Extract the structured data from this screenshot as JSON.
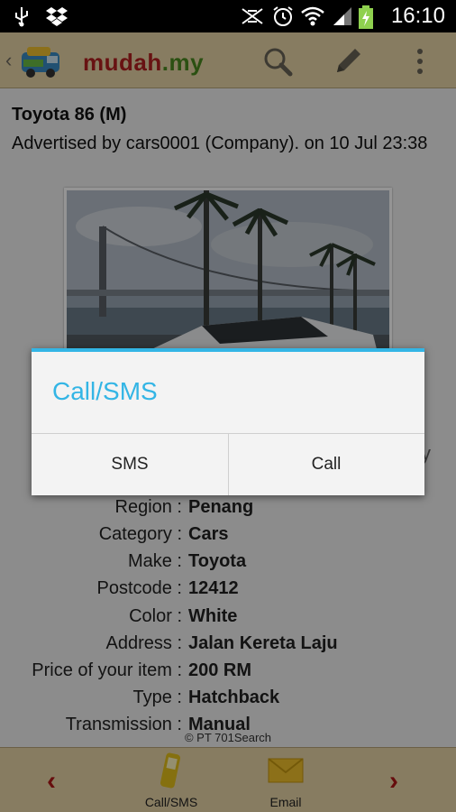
{
  "status_bar": {
    "time": "16:10",
    "icons": [
      "usb-icon",
      "dropbox-icon",
      "mute-icon",
      "alarm-icon",
      "wifi-icon",
      "signal-icon",
      "battery-charging-icon"
    ]
  },
  "action_bar": {
    "logo_text": "mudah",
    "logo_suffix": ".my",
    "icons": [
      "back-chevron-icon",
      "search-icon",
      "edit-icon",
      "overflow-menu-icon"
    ]
  },
  "ad": {
    "title": "Toyota 86 (M)",
    "advertiser_line": "Advertised by cars0001 (Company). on 10 Jul 23:38",
    "partial_text": "y",
    "details": [
      {
        "label": "Region :",
        "value": "Penang"
      },
      {
        "label": "Category :",
        "value": "Cars"
      },
      {
        "label": "Make :",
        "value": "Toyota"
      },
      {
        "label": "Postcode :",
        "value": "12412"
      },
      {
        "label": "Color :",
        "value": "White"
      },
      {
        "label": "Address :",
        "value": "Jalan Kereta Laju"
      },
      {
        "label": "Price of your item :",
        "value": "200 RM"
      },
      {
        "label": "Type :",
        "value": "Hatchback"
      },
      {
        "label": "Transmission :",
        "value": "Manual"
      }
    ]
  },
  "footer": {
    "copyright": "© PT 701Search",
    "call_sms_label": "Call/SMS",
    "email_label": "Email"
  },
  "dialog": {
    "title": "Call/SMS",
    "sms_label": "SMS",
    "call_label": "Call"
  },
  "colors": {
    "accent": "#33b5e5",
    "bar": "#e9d6a8",
    "brand_red": "#b31f1f",
    "brand_green": "#4a8a1f"
  }
}
